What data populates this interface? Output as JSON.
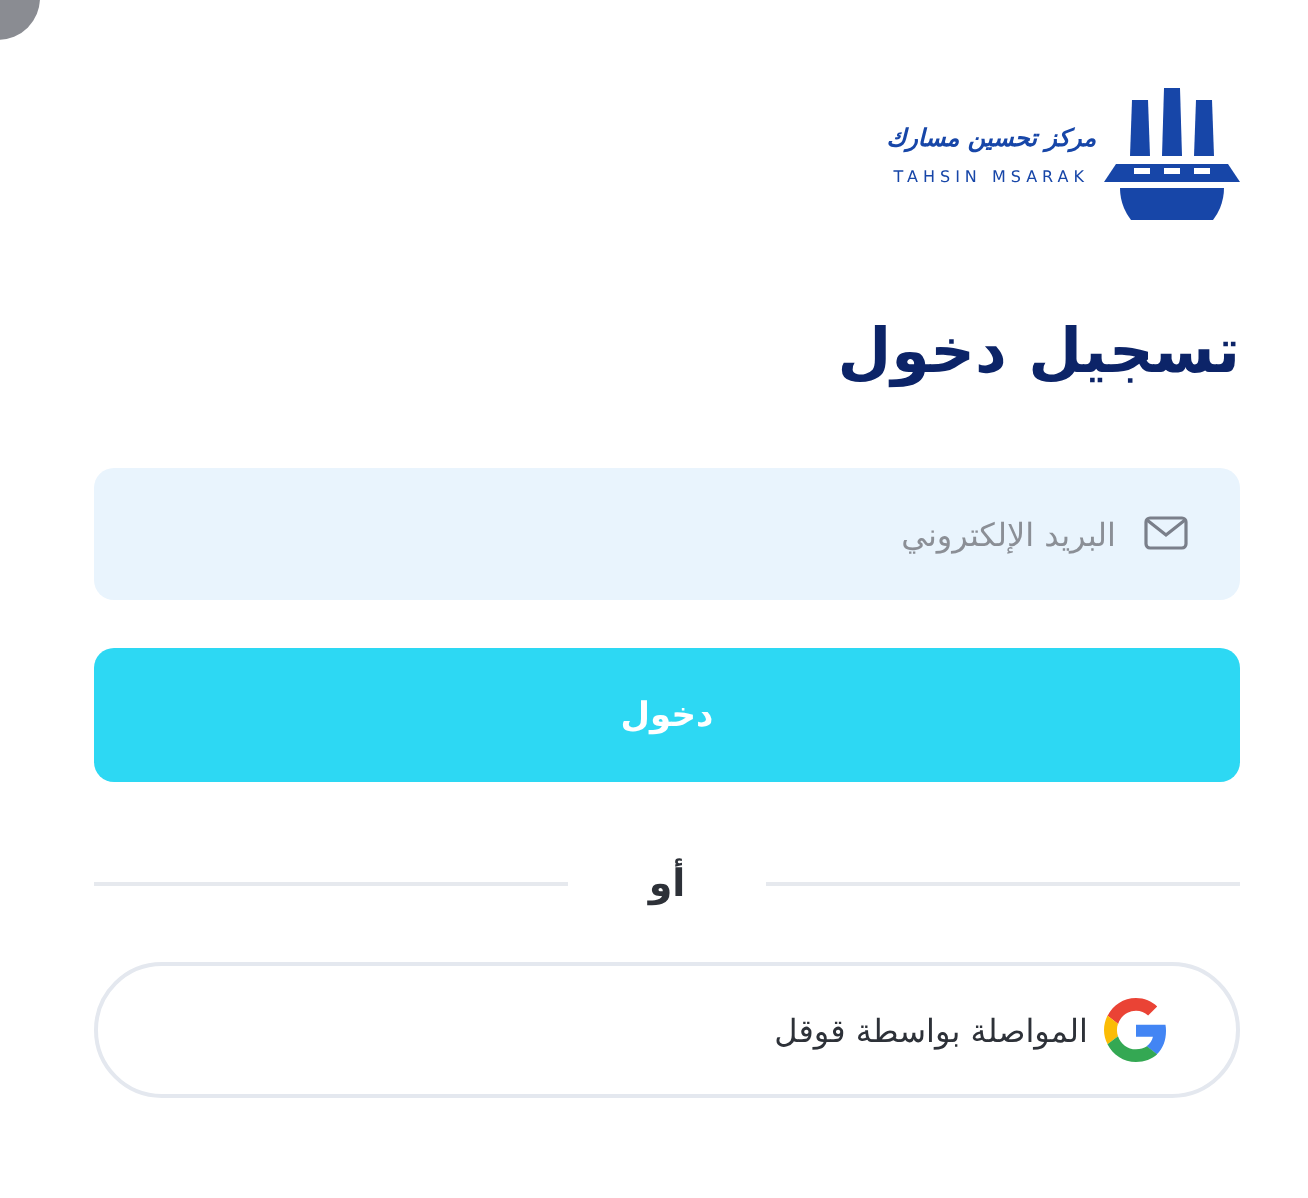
{
  "logo": {
    "name_ar": "مركز تحسين مسارك",
    "name_en": "TAHSIN MSARAK"
  },
  "title": "تسجيل دخول",
  "email_field": {
    "placeholder": "البريد الإلكتروني"
  },
  "submit_button": "دخول",
  "divider": "أو",
  "google_button": "المواصلة بواسطة قوقل"
}
